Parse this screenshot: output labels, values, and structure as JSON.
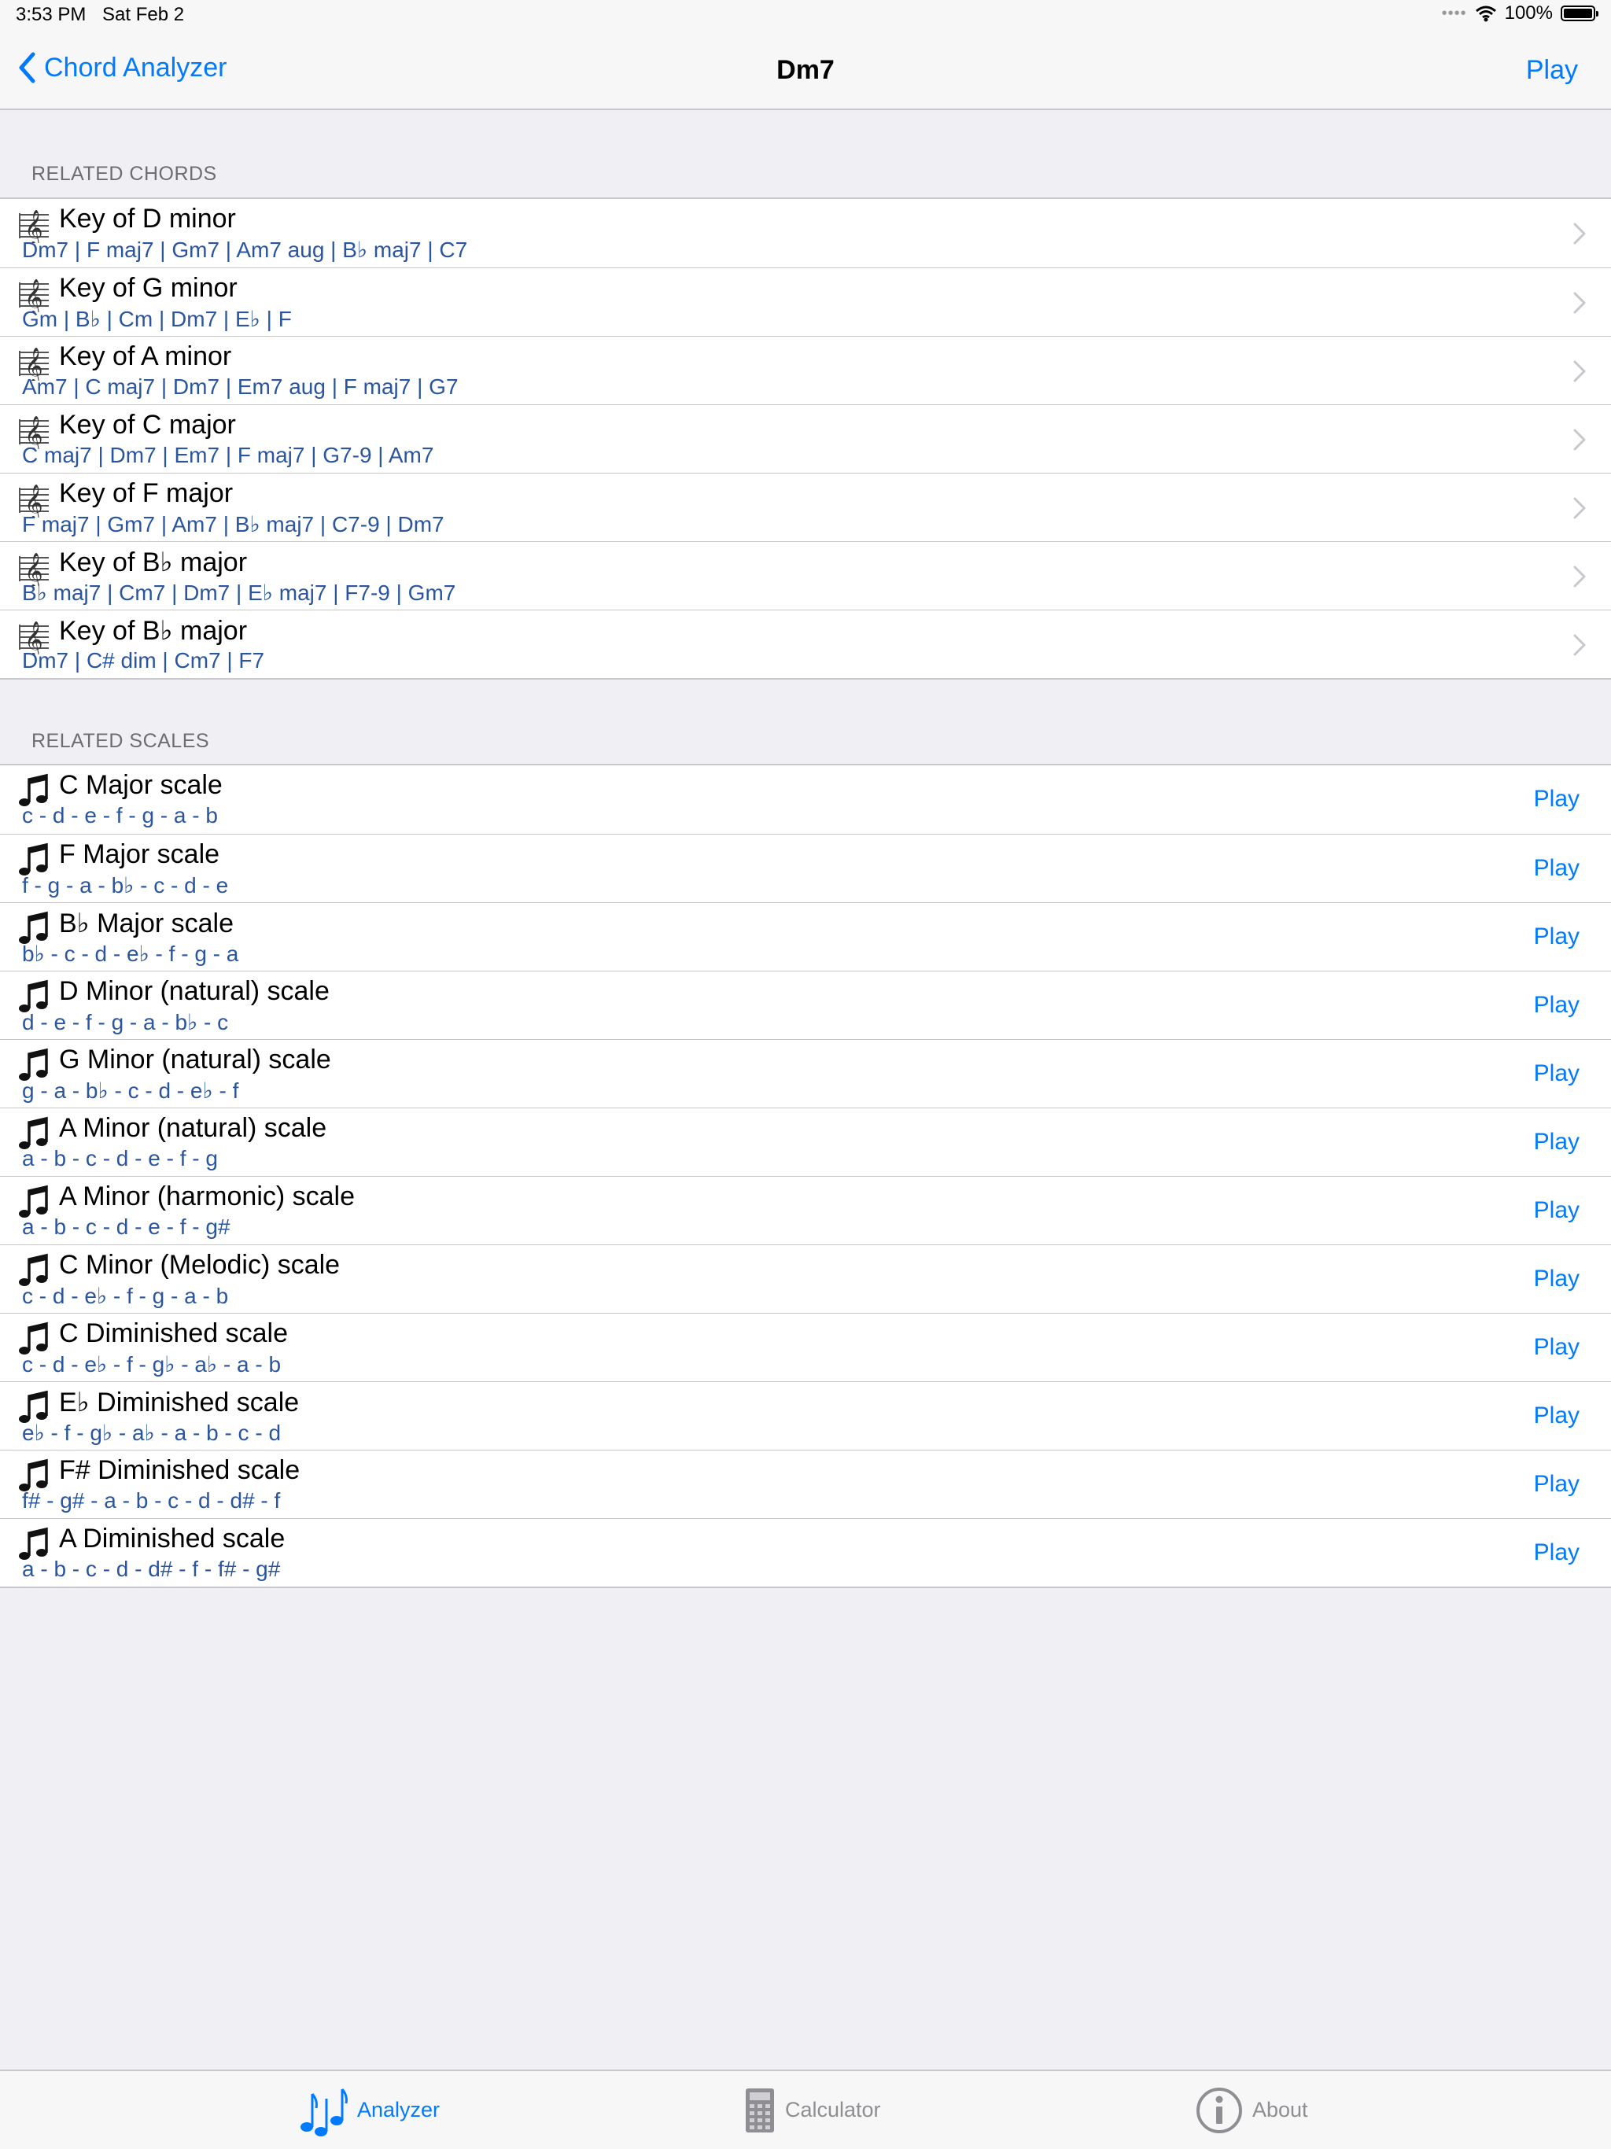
{
  "status": {
    "time": "3:53 PM",
    "date": "Sat Feb 2",
    "battery": "100%"
  },
  "nav": {
    "back_label": "Chord Analyzer",
    "title": "Dm7",
    "action_label": "Play"
  },
  "related_chords": {
    "header": "RELATED CHORDS",
    "items": [
      {
        "title": "Key of D minor",
        "chords": "Dm7 | F maj7 | Gm7 | Am7 aug | B♭ maj7 | C7"
      },
      {
        "title": "Key of G minor",
        "chords": "Gm | B♭ | Cm | Dm7 | E♭ | F"
      },
      {
        "title": "Key of A minor",
        "chords": "Am7 | C maj7 | Dm7 | Em7 aug | F maj7 | G7"
      },
      {
        "title": "Key of C major",
        "chords": "C maj7 | Dm7 | Em7 | F maj7 | G7-9 | Am7"
      },
      {
        "title": "Key of F major",
        "chords": "F maj7 | Gm7 | Am7 | B♭ maj7 | C7-9 | Dm7"
      },
      {
        "title": "Key of B♭ major",
        "chords": "B♭ maj7 | Cm7 | Dm7 | E♭ maj7 | F7-9 | Gm7"
      },
      {
        "title": "Key of B♭ major",
        "chords": "Dm7 | C# dim | Cm7 | F7"
      }
    ]
  },
  "related_scales": {
    "header": "RELATED SCALES",
    "play_label": "Play",
    "items": [
      {
        "title": "C Major scale",
        "notes": "c - d - e - f - g - a - b"
      },
      {
        "title": "F Major scale",
        "notes": "f - g - a - b♭ - c - d - e"
      },
      {
        "title": "B♭ Major scale",
        "notes": "b♭ - c - d - e♭ - f - g - a"
      },
      {
        "title": "D Minor (natural) scale",
        "notes": "d - e - f - g - a - b♭ - c"
      },
      {
        "title": "G Minor (natural) scale",
        "notes": "g - a - b♭ - c - d - e♭ - f"
      },
      {
        "title": "A Minor (natural) scale",
        "notes": "a - b - c - d - e - f - g"
      },
      {
        "title": "A Minor (harmonic) scale",
        "notes": "a - b - c - d - e - f - g#"
      },
      {
        "title": "C Minor (Melodic) scale",
        "notes": "c - d - e♭ - f - g - a - b"
      },
      {
        "title": "C Diminished scale",
        "notes": "c - d - e♭ - f - g♭ - a♭ - a - b"
      },
      {
        "title": "E♭ Diminished scale",
        "notes": "e♭ - f - g♭ - a♭ - a - b - c - d"
      },
      {
        "title": "F# Diminished scale",
        "notes": "f# - g# - a - b - c - d - d# - f"
      },
      {
        "title": "A Diminished scale",
        "notes": "a - b - c - d - d# - f - f# - g#"
      }
    ]
  },
  "tabs": [
    {
      "label": "Analyzer",
      "icon": "music-notes-icon",
      "active": true
    },
    {
      "label": "Calculator",
      "icon": "calculator-icon",
      "active": false
    },
    {
      "label": "About",
      "icon": "info-icon",
      "active": false
    }
  ],
  "colors": {
    "accent": "#007aff",
    "subtitle": "#2a55a0",
    "background": "#efeff4"
  }
}
